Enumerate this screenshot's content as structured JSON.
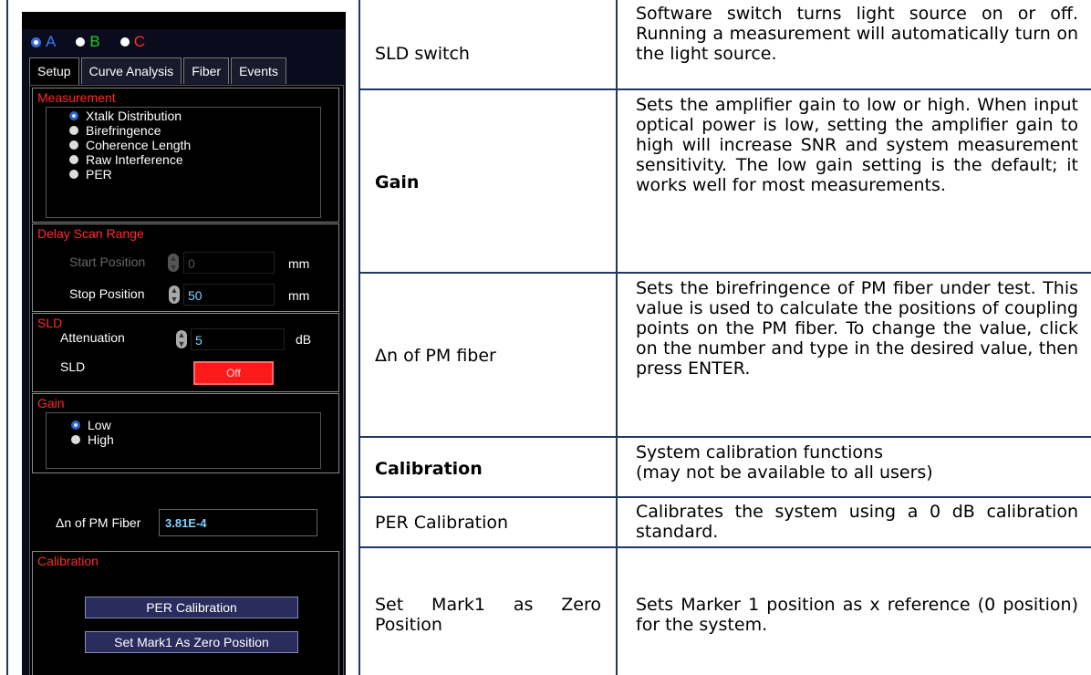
{
  "screenshot": {
    "channels": [
      {
        "label": "A",
        "color": "#3a7df0",
        "selected": true
      },
      {
        "label": "B",
        "color": "#22cc22",
        "selected": false
      },
      {
        "label": "C",
        "color": "#ff3030",
        "selected": false
      }
    ],
    "tabs": [
      "Setup",
      "Curve Analysis",
      "Fiber",
      "Events"
    ],
    "active_tab": "Setup",
    "measurement": {
      "title": "Measurement",
      "options": [
        "Xtalk Distribution",
        "Birefringence",
        "Coherence Length",
        "Raw Interference",
        "PER"
      ],
      "selected": "Xtalk Distribution"
    },
    "delay": {
      "title": "Delay Scan Range",
      "start_label": "Start Position",
      "start_value": "0",
      "stop_label": "Stop Position",
      "stop_value": "50",
      "unit": "mm"
    },
    "sld": {
      "title": "SLD",
      "atten_label": "Attenuation",
      "atten_value": "5",
      "atten_unit": "dB",
      "switch_label": "SLD",
      "switch_state": "Off"
    },
    "gain": {
      "title": "Gain",
      "options": [
        "Low",
        "High"
      ],
      "selected": "Low"
    },
    "dn": {
      "label": "Δn of PM Fiber",
      "value": "3.81E-4"
    },
    "calibration": {
      "title": "Calibration",
      "per_button": "PER Calibration",
      "mark_button": "Set Mark1 As Zero Position"
    }
  },
  "table": [
    {
      "name": "SLD switch",
      "bold": false,
      "desc": "Software switch turns light source on or off. Running a measurement will automatically turn on the light source."
    },
    {
      "name": "Gain",
      "bold": true,
      "desc": "Sets the amplifier gain to low or high. When input optical power is low, setting the amplifier gain to high will increase SNR and system measurement sensitivity. The low gain setting is the default; it works well for most measurements."
    },
    {
      "name": "Δn of PM fiber",
      "bold": false,
      "desc": "Sets the birefringence of PM fiber under test. This value is used to calculate the positions of coupling points on the PM fiber. To change the value, click on the number and type in the desired value, then press ENTER."
    },
    {
      "name": "Calibration",
      "bold": true,
      "desc_line1": "System calibration functions",
      "desc_line2": "(may not be available to all users)"
    },
    {
      "name": "PER Calibration",
      "bold": false,
      "desc": "Calibrates the system using a 0 dB calibration standard."
    },
    {
      "name": "Set Mark1 as Zero Position",
      "bold": false,
      "desc": "Sets Marker 1 position as x reference (0 position) for the system."
    }
  ]
}
